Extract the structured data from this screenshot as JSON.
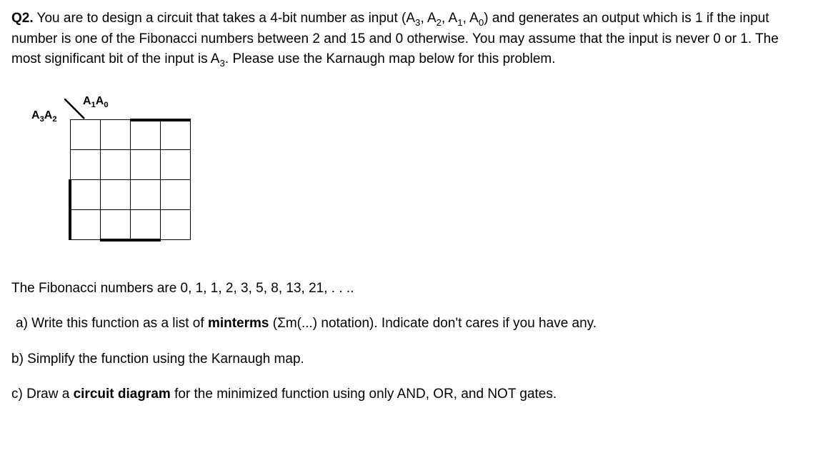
{
  "question": {
    "label": "Q2.",
    "text_parts": {
      "p1": " You are to design a circuit that takes a 4-bit number as input (A",
      "p2": ", A",
      "p3": ", A",
      "p4": ", A",
      "p5": ") and generates an output which is 1 if the input number is one of the Fibonacci numbers between 2 and 15 and 0 otherwise. You may assume that the input is never 0 or 1. The most significant bit of the input is A",
      "p6": ". Please use the Karnaugh map below for this problem."
    },
    "subs": {
      "s3": "3",
      "s2": "2",
      "s1": "1",
      "s0": "0",
      "smsb": "3"
    }
  },
  "kmap": {
    "label_top_a": "A",
    "label_top_sub1": "1",
    "label_top_b": "A",
    "label_top_sub0": "0",
    "label_left_a": "A",
    "label_left_sub3": "3",
    "label_left_b": "A",
    "label_left_sub2": "2"
  },
  "fib_statement": "The Fibonacci numbers are 0, 1, 1, 2, 3, 5, 8, 13, 21, . . ..",
  "parts": {
    "a_prefix": "a) Write this function as a list of ",
    "a_bold": "minterms",
    "a_suffix": " (Σm(...) notation). Indicate don't cares if you have any.",
    "b": "b) Simplify the function using the Karnaugh map.",
    "c_prefix": "c) Draw a ",
    "c_bold": "circuit diagram",
    "c_suffix": " for the minimized function using only AND, OR, and NOT gates."
  }
}
